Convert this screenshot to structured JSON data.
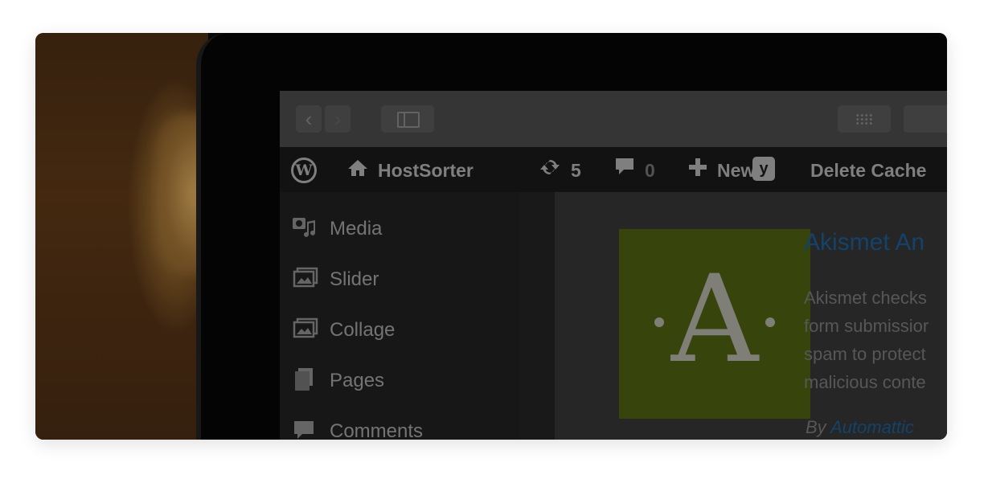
{
  "adminbar": {
    "site_name": "HostSorter",
    "updates_count": "5",
    "comments_count": "0",
    "new_label": "New",
    "delete_cache_label": "Delete Cache"
  },
  "sidebar": {
    "items": [
      {
        "label": "Media",
        "icon": "media-icon"
      },
      {
        "label": "Slider",
        "icon": "slider-icon"
      },
      {
        "label": "Collage",
        "icon": "collage-icon"
      },
      {
        "label": "Pages",
        "icon": "pages-icon"
      },
      {
        "label": "Comments",
        "icon": "comments-icon"
      }
    ]
  },
  "plugin": {
    "title": "Akismet An",
    "letter": "A",
    "description_lines": [
      "Akismet checks",
      "form submissior",
      "spam to protect",
      "malicious conte"
    ],
    "author_prefix": "By",
    "author_name": "Automattic",
    "tile_color": "#3c4a0e",
    "link_color": "#14426a"
  }
}
